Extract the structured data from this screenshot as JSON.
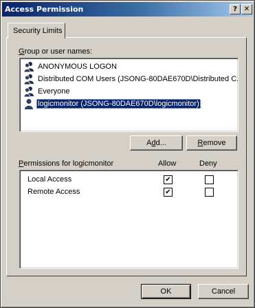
{
  "window": {
    "title": "Access Permission",
    "help_label": "?",
    "close_label": "✕"
  },
  "tab": {
    "label": "Security Limits"
  },
  "group_section": {
    "label_accel": "G",
    "label_rest": "roup or user names:",
    "users": [
      {
        "name": "ANONYMOUS LOGON",
        "icon": "user-group-icon",
        "selected": false
      },
      {
        "name": "Distributed COM Users (JSONG-80DAE670D\\Distributed C...",
        "icon": "user-group-icon",
        "selected": false
      },
      {
        "name": "Everyone",
        "icon": "user-group-icon",
        "selected": false
      },
      {
        "name": "logicmonitor (JSONG-80DAE670D\\logicmonitor)",
        "icon": "user-icon",
        "selected": true
      }
    ]
  },
  "buttons": {
    "add_accel": "d",
    "add_pre": "A",
    "add_post": "d...",
    "remove_accel": "R",
    "remove_rest": "emove",
    "ok": "OK",
    "cancel": "Cancel"
  },
  "permissions_section": {
    "label_accel": "P",
    "label_rest": "ermissions for logicmonitor",
    "allow_header": "Allow",
    "deny_header": "Deny",
    "rows": [
      {
        "name": "Local Access",
        "allow": true,
        "deny": false
      },
      {
        "name": "Remote Access",
        "allow": true,
        "deny": false
      }
    ]
  },
  "colors": {
    "dialog_face": "#d4d0c8",
    "selection": "#0a246a",
    "title_gradient_start": "#0a246a",
    "title_gradient_end": "#a6caf0"
  }
}
